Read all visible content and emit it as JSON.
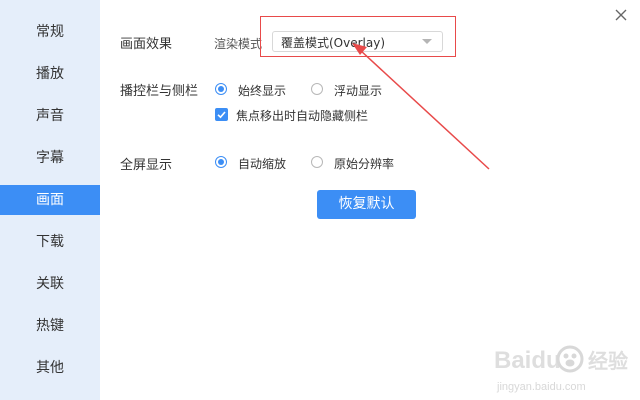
{
  "sidebar": {
    "items": [
      {
        "label": "常规"
      },
      {
        "label": "播放"
      },
      {
        "label": "声音"
      },
      {
        "label": "字幕"
      },
      {
        "label": "画面",
        "active": true
      },
      {
        "label": "下载"
      },
      {
        "label": "关联"
      },
      {
        "label": "热键"
      },
      {
        "label": "其他"
      }
    ]
  },
  "picture_effect": {
    "label": "画面效果",
    "render_mode_label": "渲染模式",
    "selected": "覆盖模式(Overlay)"
  },
  "controlbar": {
    "label": "播控栏与侧栏",
    "options": [
      "始终显示",
      "浮动显示"
    ],
    "selected_index": 0,
    "auto_hide_label": "焦点移出时自动隐藏侧栏",
    "auto_hide_checked": true
  },
  "fullscreen": {
    "label": "全屏显示",
    "options": [
      "自动缩放",
      "原始分辨率"
    ],
    "selected_index": 0
  },
  "reset_label": "恢复默认",
  "icons": {
    "close": "close-icon",
    "dropdown": "chevron-down-icon",
    "check": "check-icon"
  },
  "colors": {
    "accent": "#3c8ef5",
    "sidebar_bg": "#e5eefa",
    "annotation": "#e84a4a"
  },
  "watermark": {
    "text_latin": "Baidu",
    "text_cn": "经验",
    "url": "jingyan.baidu.com"
  }
}
